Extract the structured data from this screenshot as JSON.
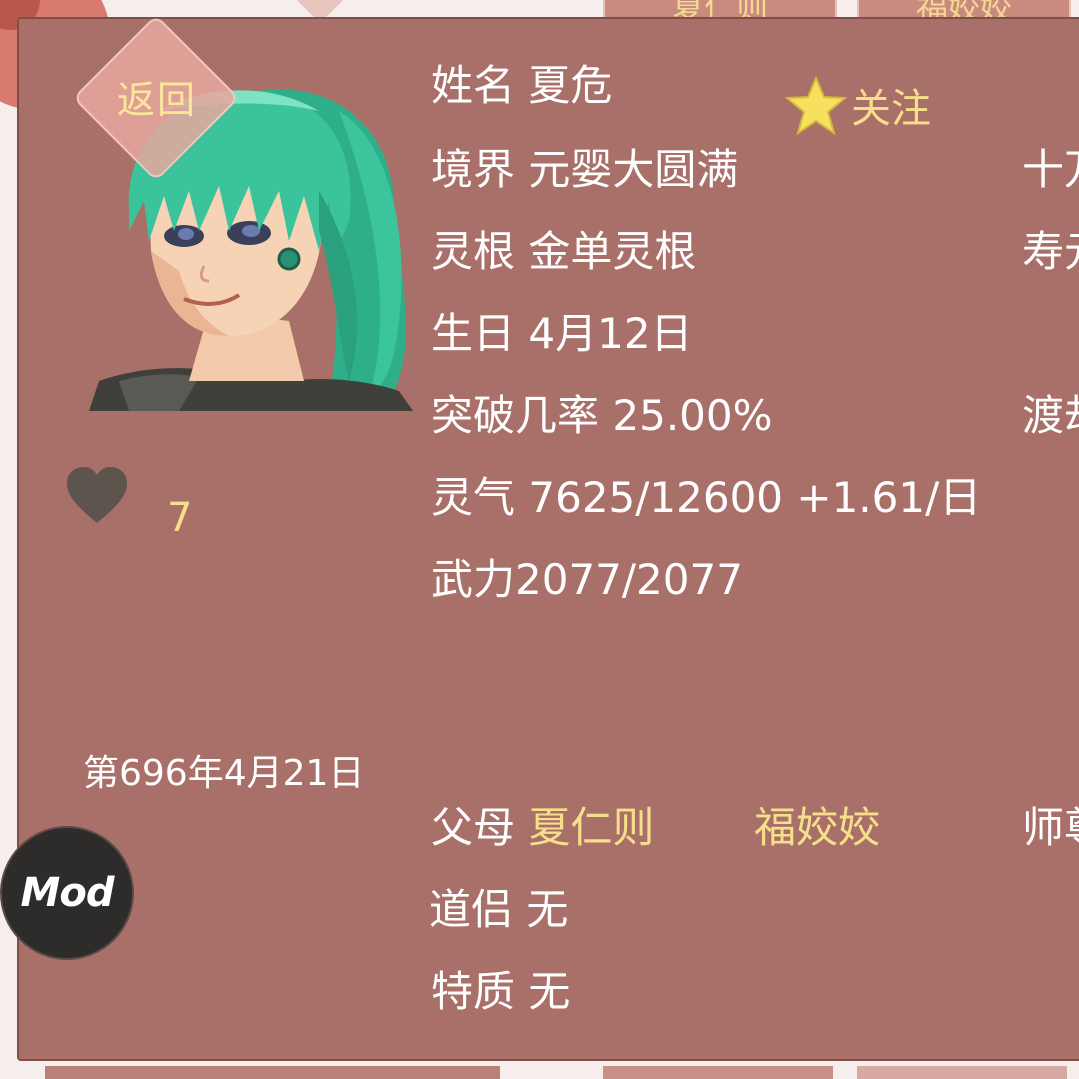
{
  "background": {
    "tab_left_label": "夏仁则",
    "tab_right_label": "福姣姣"
  },
  "back_button": {
    "label": "返回"
  },
  "follow": {
    "label": "关注",
    "icon": "star-icon",
    "color": "#f6e15e"
  },
  "character": {
    "name_label": "姓名",
    "name": "夏危",
    "realm_label": "境界",
    "realm": "元婴大圆满",
    "root_label": "灵根",
    "root": "金单灵根",
    "birthday_label": "生日",
    "birthday": "4月12日",
    "breakthrough_label": "突破几率",
    "breakthrough": "25.00%",
    "qi_label": "灵气",
    "qi": "7625/12600 +1.61/日",
    "power_label": "武力",
    "power": "2077/2077",
    "parents_label": "父母",
    "father": "夏仁则",
    "mother": "福姣姣",
    "partner_label": "道侣",
    "partner": "无",
    "trait_label": "特质",
    "trait": "无"
  },
  "right_column_cut": {
    "r1": "十万",
    "r2": "寿元",
    "r3": "渡劫",
    "r4": "师尊"
  },
  "favor": {
    "icon": "heart-icon",
    "count": "7"
  },
  "game_date": "第696年4月21日",
  "mod_button": {
    "label": "Mod"
  },
  "colors": {
    "panel": "#a9706a",
    "highlight": "#f6df8a",
    "text": "#ffffff"
  }
}
